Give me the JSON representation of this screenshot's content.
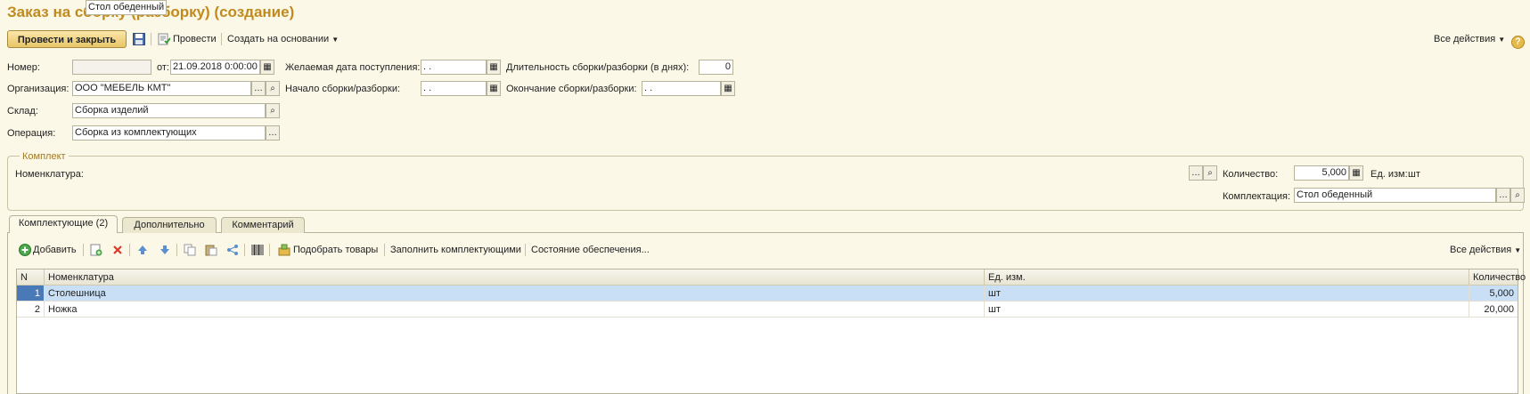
{
  "title": "Заказ на сборку (разборку) (создание)",
  "toolbar": {
    "post_close": "Провести и закрыть",
    "post": "Провести",
    "create_based": "Создать на основании",
    "all_actions": "Все действия",
    "help": "?"
  },
  "form": {
    "number_label": "Номер:",
    "number_value": "",
    "from_label": "от:",
    "date_value": "21.09.2018  0:00:00",
    "desired_date_label": "Желаемая дата поступления:",
    "desired_date_value": " .  .",
    "duration_label": "Длительность сборки/разборки (в днях):",
    "duration_value": "0",
    "org_label": "Организация:",
    "org_value": "ООО \"МЕБЕЛЬ КМТ\"",
    "start_label": "Начало сборки/разборки:",
    "start_value": " .  .",
    "end_label": "Окончание сборки/разборки:",
    "end_value": " .  .",
    "warehouse_label": "Склад:",
    "warehouse_value": "Сборка изделий",
    "operation_label": "Операция:",
    "operation_value": "Сборка из комплектующих"
  },
  "kit": {
    "caption": "Комплект",
    "nom_label": "Номенклатура:",
    "nom_value": "Стол обеденный",
    "qty_label": "Количество:",
    "qty_value": "5,000",
    "unit_label": "Ед. изм:",
    "unit_value": "шт",
    "config_label": "Комплектация:",
    "config_value": "Стол обеденный"
  },
  "tabs": [
    {
      "label": "Комплектующие (2)"
    },
    {
      "label": "Дополнительно"
    },
    {
      "label": "Комментарий"
    }
  ],
  "table_toolbar": {
    "add": "Добавить",
    "pick": "Подобрать товары",
    "fill": "Заполнить комплектующими",
    "status": "Состояние обеспечения...",
    "all_actions": "Все действия"
  },
  "table": {
    "columns": [
      "N",
      "Номенклатура",
      "Ед. изм.",
      "Количество"
    ],
    "rows": [
      {
        "n": "1",
        "name": "Столешница",
        "unit": "шт",
        "qty": "5,000"
      },
      {
        "n": "2",
        "name": "Ножка",
        "unit": "шт",
        "qty": "20,000"
      }
    ]
  },
  "colors": {
    "background": "#fbf8e8",
    "title": "#c18a1e",
    "selected_row": "#c9dff5",
    "selected_num": "#4a79b8"
  }
}
